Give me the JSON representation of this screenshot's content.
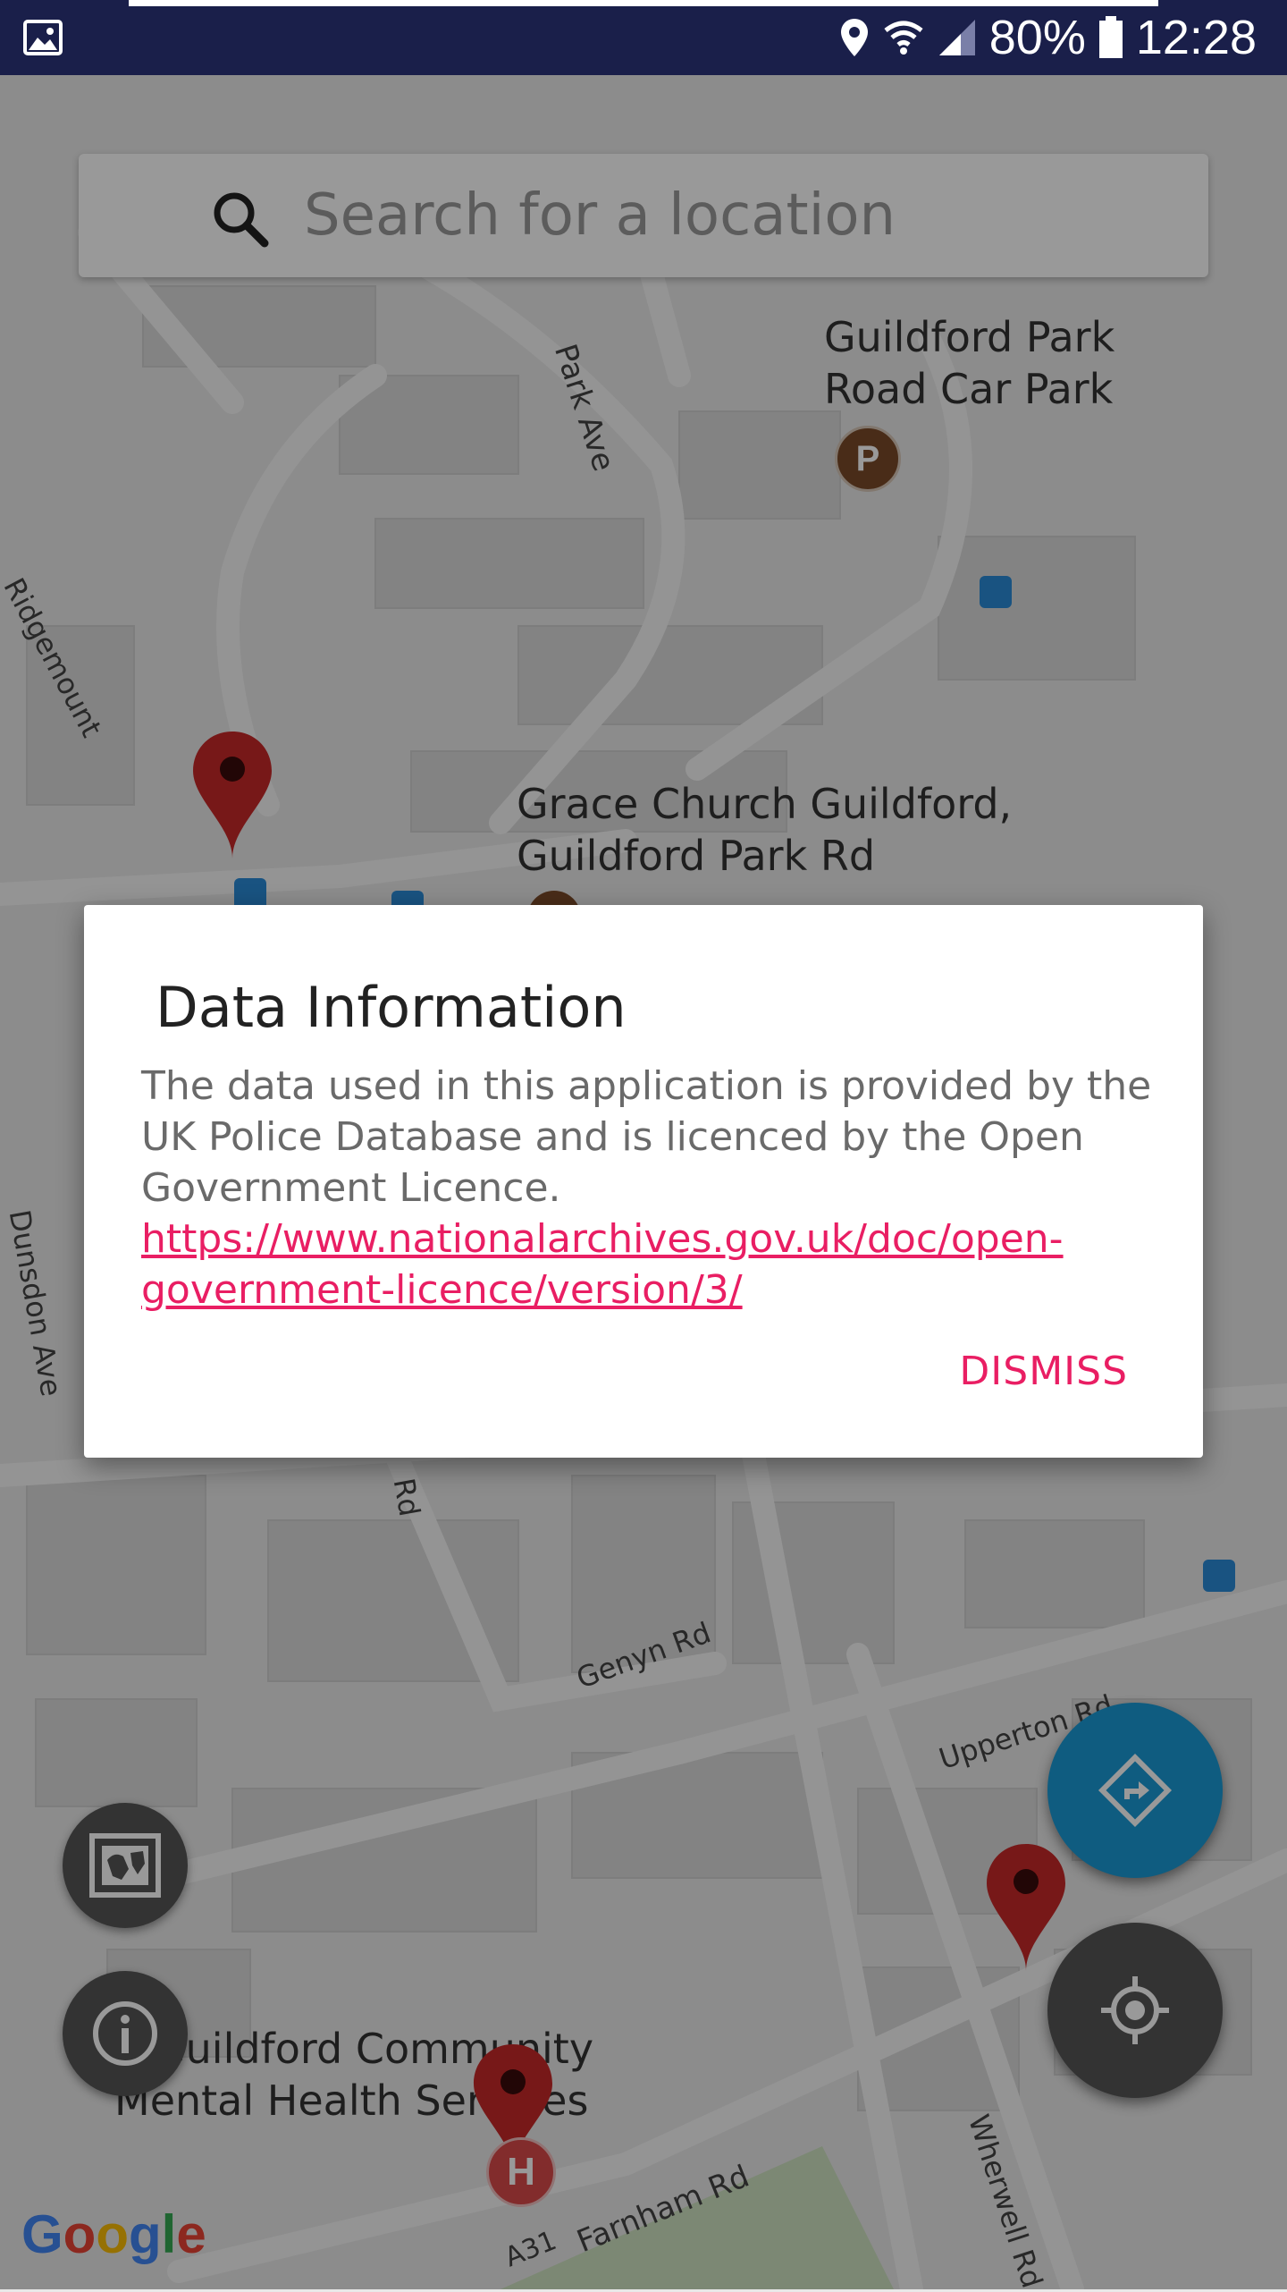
{
  "status_bar": {
    "battery": "80%",
    "time": "12:28"
  },
  "search": {
    "placeholder": "Search for a location"
  },
  "map": {
    "poi_labels": [
      {
        "text_lines": [
          "Guildford Park",
          "Road Car Park"
        ]
      },
      {
        "text_lines": [
          "Grace Church Guildford,",
          "Guildford Park Rd"
        ]
      },
      {
        "text_lines": [
          "Guildford Community",
          "Mental Health Services"
        ]
      }
    ],
    "street_labels": [
      "Park Ave",
      "Ridgemount",
      "Dunsdon Ave",
      "Rd",
      "Genyn Rd",
      "Upperton Rd",
      "Wherwell Rd",
      "A31",
      "Farnham Rd"
    ],
    "parking_icon_text": "P",
    "hospital_icon_text": "H"
  },
  "dialog": {
    "title": "Data Information",
    "body_text": "The data used in this application is provided by the UK Police Database and is licenced by the Open Government Licence. ",
    "link_text": "https://www.nationalarchives.gov.uk/doc/open-government-licence/version/3/",
    "dismiss_label": "DISMISS"
  },
  "controls": {
    "map_type_icon": "map-icon",
    "info_icon": "info-icon",
    "directions_icon": "directions-icon",
    "my_location_icon": "my-location-icon"
  },
  "attribution": {
    "google_letters": [
      "G",
      "o",
      "o",
      "g",
      "l",
      "e"
    ],
    "google_colors": [
      "#4285F4",
      "#EA4335",
      "#FBBC05",
      "#4285F4",
      "#34A853",
      "#EA4335"
    ]
  },
  "colors": {
    "accent": "#e91e63",
    "status_bar": "#1a1f4a",
    "fab_directions": "#0a6b8c",
    "marker": "#8b1a1a"
  }
}
